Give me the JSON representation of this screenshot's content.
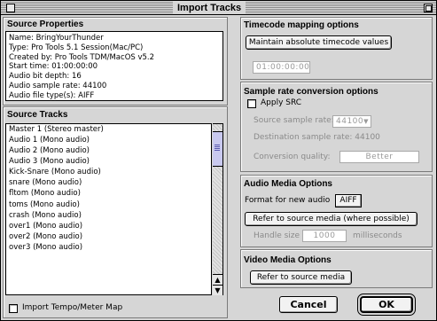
{
  "window": {
    "title": "Import Tracks"
  },
  "source_properties": {
    "heading": "Source Properties",
    "lines": [
      "Name: BringYourThunder",
      "Type: Pro Tools 5.1 Session(Mac/PC)",
      "Created by: Pro Tools TDM/MacOS v5.2",
      "Start time: 01:00:00:00",
      "Audio bit depth: 16",
      "Audio sample rate: 44100",
      "Audio file type(s): AIFF"
    ]
  },
  "source_tracks": {
    "heading": "Source Tracks",
    "items": [
      "Master 1 (Stereo master)",
      "Audio 1 (Mono audio)",
      "Audio 2 (Mono audio)",
      "Audio 3 (Mono audio)",
      "Kick-Snare (Mono audio)",
      "snare (Mono audio)",
      "fltom (Mono audio)",
      "toms (Mono audio)",
      "crash (Mono audio)",
      "over1 (Mono audio)",
      "over2 (Mono audio)",
      "over3 (Mono audio)"
    ],
    "import_tempo_label": "Import Tempo/Meter Map"
  },
  "timecode": {
    "heading": "Timecode mapping options",
    "mode_button": "Maintain absolute timecode values",
    "value": "01:00:00:00"
  },
  "sample_rate": {
    "heading": "Sample rate conversion options",
    "apply_label": "Apply SRC",
    "source_label": "Source sample rate:",
    "source_value": "44100",
    "destination_label": "Destination sample rate:",
    "destination_value": "44100",
    "quality_label": "Conversion quality:",
    "quality_value": "Better"
  },
  "audio_media": {
    "heading": "Audio Media Options",
    "format_label": "Format for new audio",
    "format_value": "AIFF",
    "refer_button": "Refer to source media (where possible)",
    "handle_label": "Handle size",
    "handle_value": "1000",
    "handle_unit": "milliseconds"
  },
  "video_media": {
    "heading": "Video Media Options",
    "refer_button": "Refer to source media"
  },
  "actions": {
    "cancel": "Cancel",
    "ok": "OK"
  }
}
